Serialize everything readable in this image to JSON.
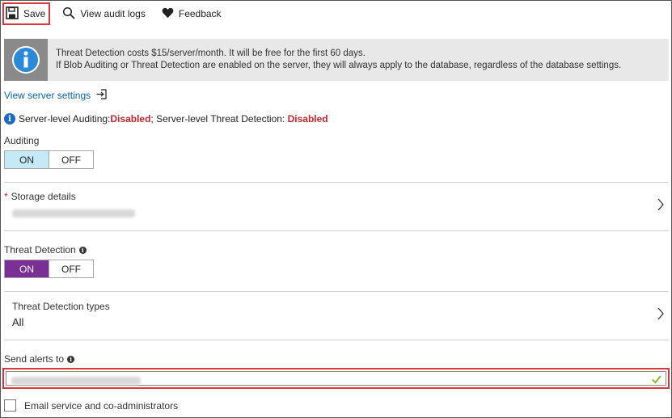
{
  "toolbar": {
    "save_label": "Save",
    "audit_logs_label": "View audit logs",
    "feedback_label": "Feedback"
  },
  "banner": {
    "line1": "Threat Detection costs $15/server/month. It will be free for the first 60 days.",
    "line2": "If Blob Auditing or Threat Detection are enabled on the server, they will always apply to the database, regardless of the database settings."
  },
  "server_link": {
    "label": "View server settings"
  },
  "server_status": {
    "auditing_prefix": "Server-level Auditing: ",
    "auditing_value": "Disabled",
    "separator": "; Server-level Threat Detection: ",
    "threat_value": "Disabled"
  },
  "auditing": {
    "label": "Auditing",
    "on_label": "ON",
    "off_label": "OFF",
    "selected": "ON"
  },
  "storage": {
    "required_mark": "*",
    "label": "Storage details"
  },
  "threat_detection": {
    "label": "Threat Detection",
    "on_label": "ON",
    "off_label": "OFF",
    "selected": "ON"
  },
  "threat_types": {
    "label": "Threat Detection types",
    "value": "All"
  },
  "send_alerts": {
    "label": "Send alerts to",
    "value": ""
  },
  "email_admins": {
    "label": "Email service and co-administrators",
    "checked": false
  },
  "colors": {
    "accent_blue": "#0a63b0",
    "disabled_red": "#c4262e",
    "toggle_on_blue": "#c5e9f7",
    "toggle_on_purple": "#7a2f94",
    "highlight_red": "#d9373f",
    "valid_green": "#7ab51d"
  },
  "icons": {
    "save": "save-icon",
    "audit_logs": "search-icon",
    "feedback": "heart-icon",
    "banner": "info-icon",
    "server_link": "sign-in-icon",
    "chevron": "chevron-right-icon",
    "valid": "checkmark-icon"
  }
}
